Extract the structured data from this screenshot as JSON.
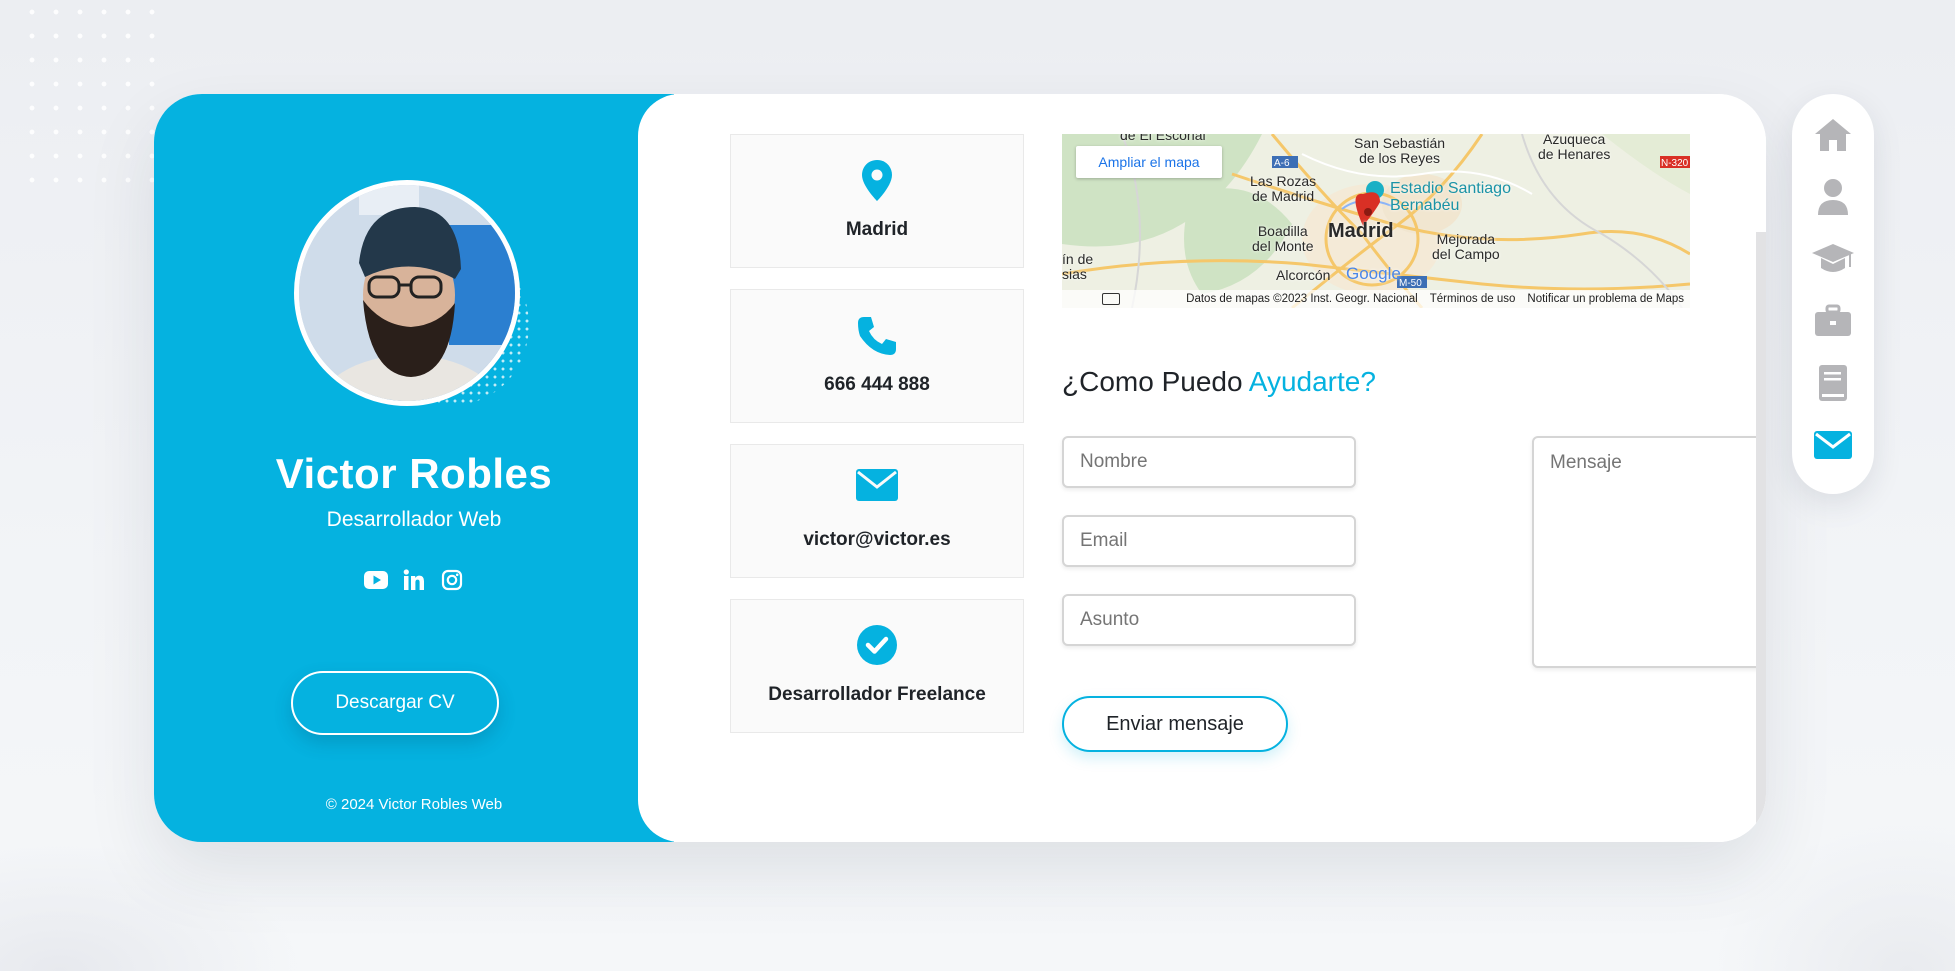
{
  "profile": {
    "name": "Victor Robles",
    "role": "Desarrollador Web",
    "cv_button": "Descargar CV",
    "copyright": "© 2024 Victor Robles Web",
    "social": [
      "youtube-icon",
      "linkedin-icon",
      "instagram-icon"
    ]
  },
  "info_cards": [
    {
      "icon": "map-pin-icon",
      "label": "Madrid"
    },
    {
      "icon": "phone-icon",
      "label": "666 444 888"
    },
    {
      "icon": "envelope-icon",
      "label": "victor@victor.es"
    },
    {
      "icon": "check-circle-icon",
      "label": "Desarrollador Freelance"
    }
  ],
  "map": {
    "enlarge_label": "Ampliar el mapa",
    "footer": {
      "data": "Datos de mapas ©2023 Inst. Geogr. Nacional",
      "terms": "Términos de uso",
      "report": "Notificar un problema de Maps"
    },
    "places": {
      "escorial": "de El Escorial",
      "san_sebastian": "San Sebastián\nde los Reyes",
      "azuqueca": "Azuqueca\nde Henares",
      "las_rozas": "Las Rozas\nde Madrid",
      "estadio": "Estadio Santiago\nBernabéu",
      "boadilla": "Boadilla\ndel Monte",
      "madrid": "Madrid",
      "mejorada": "Mejorada\ndel Campo",
      "in_de": "ín de\nsias",
      "alcorcon": "Alcorcón",
      "google": "Google",
      "a6": "A-6",
      "n320": "N-320",
      "m50": "M-50"
    }
  },
  "contact": {
    "title_part1": "¿Como Puedo ",
    "title_part2": "Ayudarte?",
    "name_placeholder": "Nombre",
    "email_placeholder": "Email",
    "subject_placeholder": "Asunto",
    "message_placeholder": "Mensaje",
    "send_button": "Enviar mensaje"
  },
  "nav": {
    "items": [
      "home-icon",
      "user-icon",
      "graduation-cap-icon",
      "briefcase-icon",
      "book-icon",
      "envelope-icon"
    ],
    "active": "envelope-icon"
  },
  "colors": {
    "accent": "#05b2e0",
    "nav_inactive": "#b5b5b8",
    "text_dark": "#1f2328"
  }
}
